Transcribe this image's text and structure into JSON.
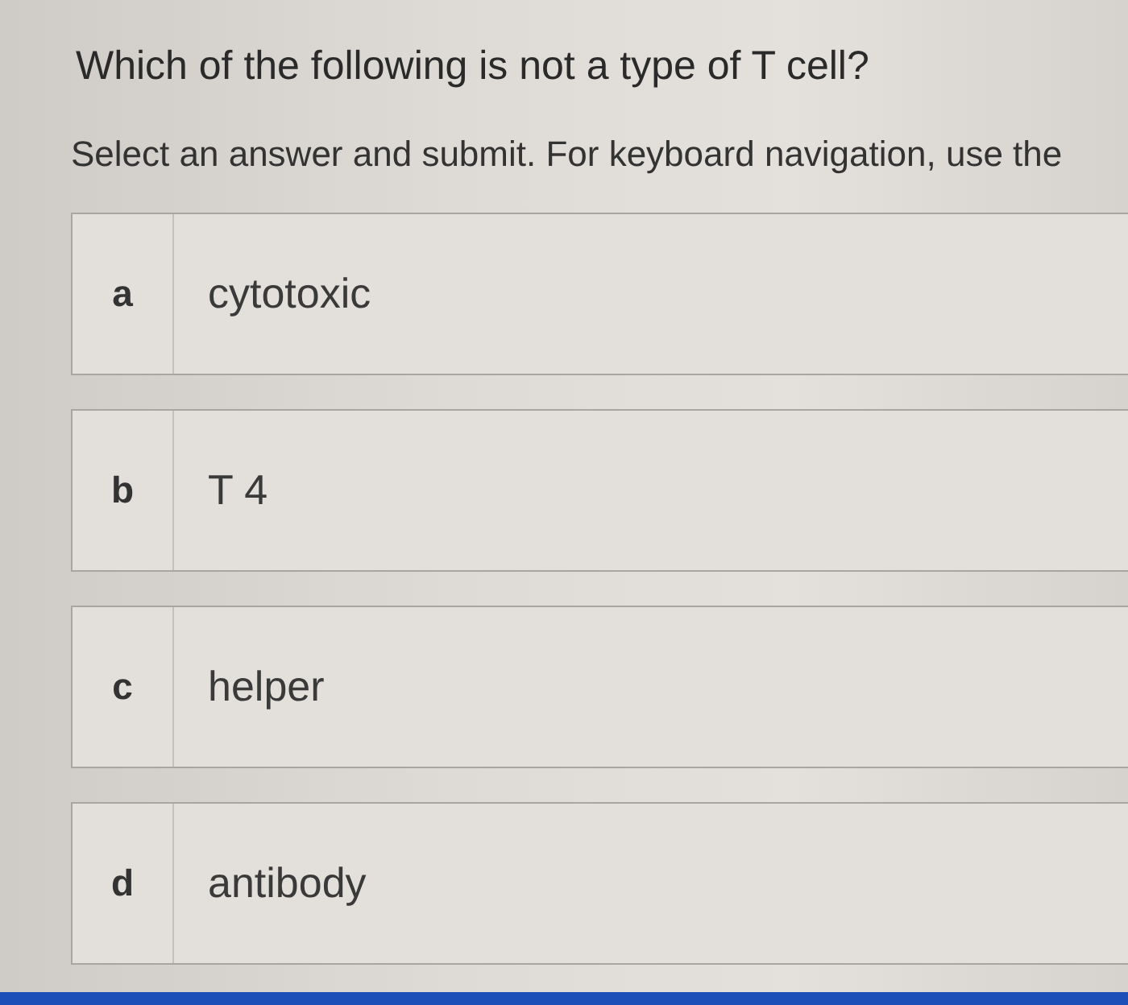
{
  "question": "Which of the following is not a type of T cell?",
  "instruction": "Select an answer and submit. For keyboard navigation, use the",
  "options": [
    {
      "letter": "a",
      "text": "cytotoxic",
      "selected": false
    },
    {
      "letter": "b",
      "text": "T 4",
      "selected": false
    },
    {
      "letter": "c",
      "text": "helper",
      "selected": false
    },
    {
      "letter": "d",
      "text": "antibody",
      "selected": false
    }
  ]
}
